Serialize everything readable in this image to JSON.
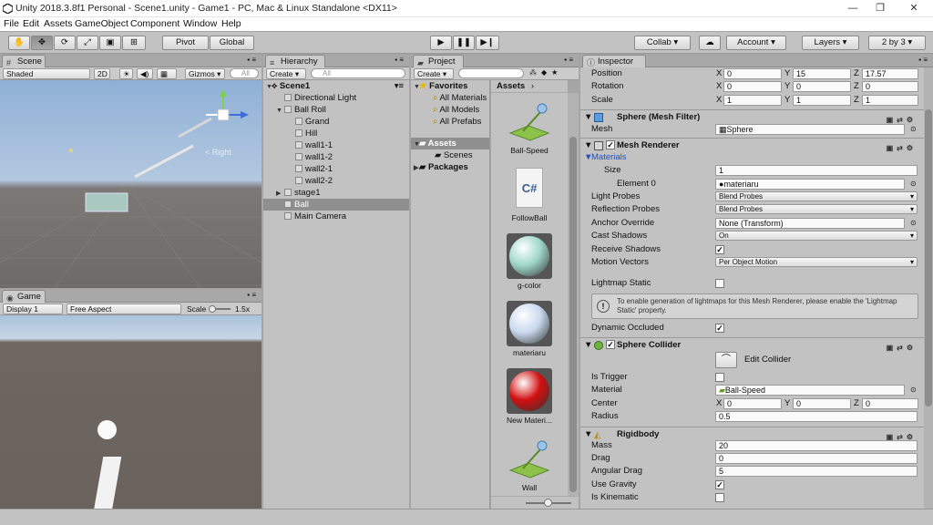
{
  "titlebar": {
    "title": "Unity 2018.3.8f1 Personal - Scene1.unity - Game1 - PC, Mac & Linux Standalone <DX11>"
  },
  "menu": [
    "File",
    "Edit",
    "Assets",
    "GameObject",
    "Component",
    "Window",
    "Help"
  ],
  "toolbar": {
    "pivot": "Pivot",
    "global": "Global",
    "collab": "Collab ▾",
    "account": "Account",
    "layers": "Layers",
    "layout": "2 by 3"
  },
  "scene": {
    "tab": "Scene",
    "shading": "Shaded",
    "mode2d": "2D",
    "gizmos": "Gizmos ▾",
    "search_placeholder": "All",
    "gizmo_label": "< Right"
  },
  "game": {
    "tab": "Game",
    "display": "Display 1",
    "aspect": "Free Aspect",
    "scale_label": "Scale",
    "scale_value": "1.5x"
  },
  "hierarchy": {
    "tab": "Hierarchy",
    "create": "Create ▾",
    "search_placeholder": "All",
    "scene": "Scene1",
    "items": [
      {
        "label": "Directional Light",
        "indent": 1,
        "fold": ""
      },
      {
        "label": "Ball Roll",
        "indent": 1,
        "fold": "▼"
      },
      {
        "label": "Grand",
        "indent": 2,
        "fold": ""
      },
      {
        "label": "Hill",
        "indent": 2,
        "fold": ""
      },
      {
        "label": "wall1-1",
        "indent": 2,
        "fold": ""
      },
      {
        "label": "wall1-2",
        "indent": 2,
        "fold": ""
      },
      {
        "label": "wall2-1",
        "indent": 2,
        "fold": ""
      },
      {
        "label": "wall2-2",
        "indent": 2,
        "fold": ""
      },
      {
        "label": "stage1",
        "indent": 1,
        "fold": "▶"
      },
      {
        "label": "Ball",
        "indent": 1,
        "fold": "",
        "selected": true
      },
      {
        "label": "Main Camera",
        "indent": 1,
        "fold": ""
      }
    ]
  },
  "project": {
    "tab": "Project",
    "create": "Create ▾",
    "favorites": "Favorites",
    "fav_items": [
      "All Materials",
      "All Models",
      "All Prefabs"
    ],
    "assets_folder": "Assets",
    "scenes_folder": "Scenes",
    "packages_folder": "Packages",
    "breadcrumb": "Assets",
    "assets": [
      {
        "name": "Ball-Speed",
        "kind": "physic"
      },
      {
        "name": "FollowBall",
        "kind": "script"
      },
      {
        "name": "g-color",
        "kind": "sphere",
        "color": "#9fd8c8"
      },
      {
        "name": "materiaru",
        "kind": "sphere",
        "color": "#c9d9ee"
      },
      {
        "name": "New Materi...",
        "kind": "sphere",
        "color": "#d11010"
      },
      {
        "name": "Wall",
        "kind": "physic"
      }
    ]
  },
  "inspector": {
    "tab": "Inspector",
    "transform": {
      "position": {
        "label": "Position",
        "x": "0",
        "y": "15",
        "z": "17.57"
      },
      "rotation": {
        "label": "Rotation",
        "x": "0",
        "y": "0",
        "z": "0"
      },
      "scale": {
        "label": "Scale",
        "x": "1",
        "y": "1",
        "z": "1"
      }
    },
    "mesh_filter": {
      "title": "Sphere (Mesh Filter)",
      "mesh_label": "Mesh",
      "mesh_value": "Sphere"
    },
    "mesh_renderer": {
      "title": "Mesh Renderer",
      "materials": "Materials",
      "size_label": "Size",
      "size_value": "1",
      "element_label": "Element 0",
      "element_value": "materiaru",
      "light_probes_label": "Light Probes",
      "light_probes": "Blend Probes",
      "reflection_label": "Reflection Probes",
      "reflection": "Blend Probes",
      "anchor_label": "Anchor Override",
      "anchor": "None (Transform)",
      "cast_label": "Cast Shadows",
      "cast": "On",
      "receive_label": "Receive Shadows",
      "motion_label": "Motion Vectors",
      "motion": "Per Object Motion",
      "lightmap_label": "Lightmap Static",
      "info": "To enable generation of lightmaps for this Mesh Renderer, please enable the 'Lightmap Static' property.",
      "dynamic_label": "Dynamic Occluded"
    },
    "sphere_collider": {
      "title": "Sphere Collider",
      "edit": "Edit Collider",
      "trigger_label": "Is Trigger",
      "material_label": "Material",
      "material": "Ball-Speed",
      "center_label": "Center",
      "cx": "0",
      "cy": "0",
      "cz": "0",
      "radius_label": "Radius",
      "radius": "0.5"
    },
    "rigidbody": {
      "title": "Rigidbody",
      "mass_label": "Mass",
      "mass": "20",
      "drag_label": "Drag",
      "drag": "0",
      "angular_label": "Angular Drag",
      "angular": "5",
      "gravity_label": "Use Gravity",
      "kinematic_label": "Is Kinematic"
    }
  }
}
